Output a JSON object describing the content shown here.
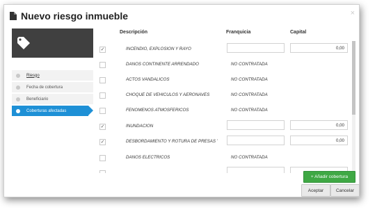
{
  "dialog": {
    "title": "Nuevo riesgo inmueble",
    "close_glyph": "×"
  },
  "sidebar": {
    "logo_icon": "tag-icon",
    "items": [
      {
        "label": "Riesgo",
        "state": "link"
      },
      {
        "label": "Fecha de cobertura",
        "state": "normal"
      },
      {
        "label": "Beneficiario",
        "state": "normal"
      },
      {
        "label": "Coberturas afectadas",
        "state": "active"
      }
    ]
  },
  "table": {
    "headers": {
      "description": "Descripción",
      "franchise": "Franquicia",
      "capital": "Capital"
    },
    "rows": [
      {
        "checked": true,
        "description": "INCENDIO, EXPLOSION Y RAYO",
        "franchise": "",
        "capital": "0,00",
        "contracted": true
      },
      {
        "checked": false,
        "description": "DAÑOS CONTINENTE ARRENDADO",
        "status": "NO CONTRATADA",
        "contracted": false
      },
      {
        "checked": false,
        "description": "ACTOS VANDALICOS",
        "status": "NO CONTRATADA",
        "contracted": false
      },
      {
        "checked": false,
        "description": "CHOQUE DE VEHICULOS Y AERONAVES",
        "status": "NO CONTRATADA",
        "contracted": false
      },
      {
        "checked": false,
        "description": "FENOMENOS ATMOSFERICOS",
        "status": "NO CONTRATADA",
        "contracted": false
      },
      {
        "checked": true,
        "description": "INUNDACION",
        "franchise": "",
        "capital": "0,00",
        "contracted": true
      },
      {
        "checked": true,
        "description": "DESBORDAMIENTO Y ROTURA DE PRESAS Y",
        "franchise": "",
        "capital": "0,00",
        "contracted": true
      },
      {
        "checked": false,
        "description": "DAÑOS ELECTRICOS",
        "status": "NO CONTRATADA",
        "contracted": false
      }
    ]
  },
  "buttons": {
    "add_coverage": "+ Añadir cobertura",
    "accept": "Aceptar",
    "cancel": "Cancelar"
  },
  "colors": {
    "accent": "#1e90d6",
    "add_button": "#3fa844",
    "logo_bg": "#404040"
  }
}
